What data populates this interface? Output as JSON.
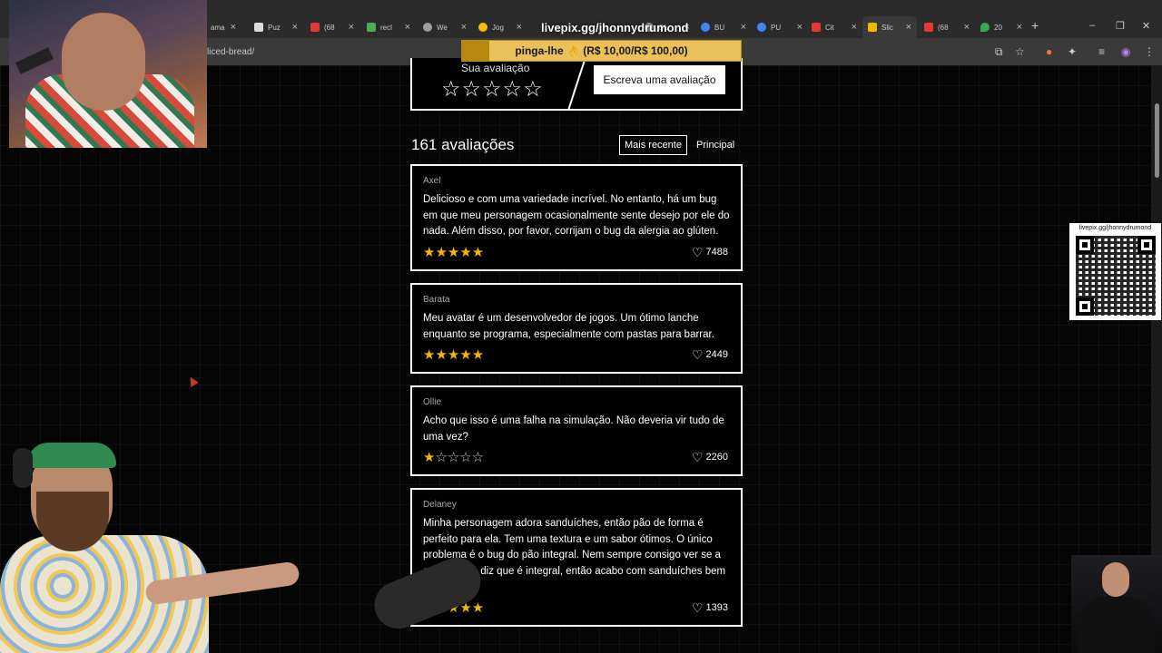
{
  "browser": {
    "tabs": [
      {
        "label": "ama",
        "color": "#888888"
      },
      {
        "label": "Puz",
        "color": "#dddddd"
      },
      {
        "label": "(68",
        "color": "#e53935"
      },
      {
        "label": "recl",
        "color": "#4caf50"
      },
      {
        "label": "We",
        "color": "#9e9e9e"
      },
      {
        "label": "Jog",
        "color": "#fbbc05"
      },
      {
        "label": "OL",
        "color": "#999999"
      },
      {
        "label": "BU",
        "color": "#4285f4"
      },
      {
        "label": "PU",
        "color": "#4285f4"
      },
      {
        "label": "Cit",
        "color": "#e53935"
      },
      {
        "label": "Slic",
        "color": "#f5b700"
      },
      {
        "label": "(68",
        "color": "#e53935"
      },
      {
        "label": "20",
        "color": "#34a853"
      }
    ],
    "url_partial": "liced-bread/",
    "new_tab": "+",
    "window_controls": {
      "minimize": "–",
      "restore": "❐",
      "close": "✕"
    }
  },
  "stream": {
    "overlay_title": "livepix.gg/jhonnydrumond",
    "pix_banner": "pinga-lhe 👌 (R$ 10,00/R$ 100,00)",
    "qr_caption": "livepix.gg/jhonnydrumond"
  },
  "rating_prompt": {
    "label": "Sua avaliação",
    "stars": "☆☆☆☆☆",
    "write_button": "Escreva uma avaliação"
  },
  "reviews_header": {
    "count_label": "161 avaliações",
    "sort_recent": "Mais recente",
    "sort_top": "Principal"
  },
  "reviews": [
    {
      "author": "Axel",
      "text": "Delicioso e com uma variedade incrível. No entanto, há um bug em que meu personagem ocasionalmente sente desejo por ele do nada. Além disso, por favor, corrijam o bug da alergia ao glúten.",
      "rating": 5,
      "stars_filled": "★★★★★",
      "stars_empty": "",
      "likes": "7488"
    },
    {
      "author": "Barata",
      "text": "Meu avatar é um desenvolvedor de jogos. Um ótimo lanche enquanto se programa, especialmente com pastas para barrar.",
      "rating": 5,
      "stars_filled": "★★★★★",
      "stars_empty": "",
      "likes": "2449"
    },
    {
      "author": "Ollie",
      "text": "Acho que isso é uma falha na simulação. Não deveria vir tudo de uma vez?",
      "rating": 1,
      "stars_filled": "★",
      "stars_empty": "☆☆☆☆",
      "likes": "2260"
    },
    {
      "author": "Delaney",
      "text": "Minha personagem adora sanduíches, então pão de forma é perfeito para ela. Tem uma textura e um sabor ótimos. O único problema é o bug do pão integral. Nem sempre consigo ver se a embalagem diz que é integral, então acabo com sanduíches bem",
      "rating": 5,
      "stars_filled": "★★★★★",
      "stars_empty": "",
      "likes": "1393"
    }
  ],
  "colors": {
    "star": "#f5b700",
    "pix_banner": "#e8c15a",
    "background": "#050505"
  }
}
